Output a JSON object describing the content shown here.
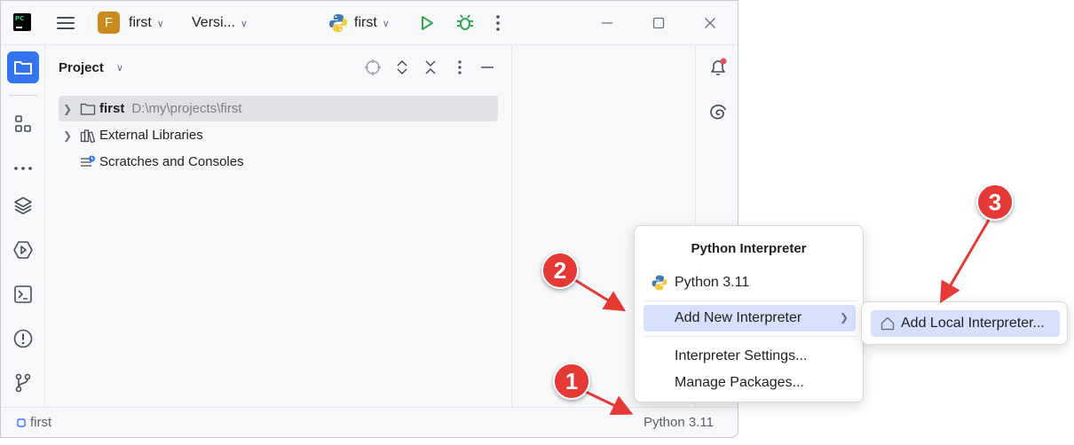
{
  "window": {
    "project_badge": "F",
    "project_name": "first",
    "vcs_label": "Versi...",
    "run_config": "first"
  },
  "project_panel": {
    "title": "Project",
    "tree": [
      {
        "label": "first",
        "path": "D:\\my\\projects\\first"
      },
      {
        "label": "External Libraries"
      },
      {
        "label": "Scratches and Consoles"
      }
    ]
  },
  "status_bar": {
    "project": "first",
    "interpreter": "Python 3.11"
  },
  "interpreter_popup": {
    "title": "Python Interpreter",
    "items": [
      {
        "label": "Python 3.11"
      },
      {
        "label": "Add New Interpreter"
      },
      {
        "label": "Interpreter Settings..."
      },
      {
        "label": "Manage Packages..."
      }
    ],
    "submenu": {
      "label": "Add Local Interpreter..."
    }
  },
  "annotations": [
    {
      "number": "1"
    },
    {
      "number": "2"
    },
    {
      "number": "3"
    }
  ],
  "colors": {
    "accent": "#3574f0",
    "annotation": "#e53935",
    "highlight": "#d5e1fb",
    "run": "#2fa84f"
  }
}
